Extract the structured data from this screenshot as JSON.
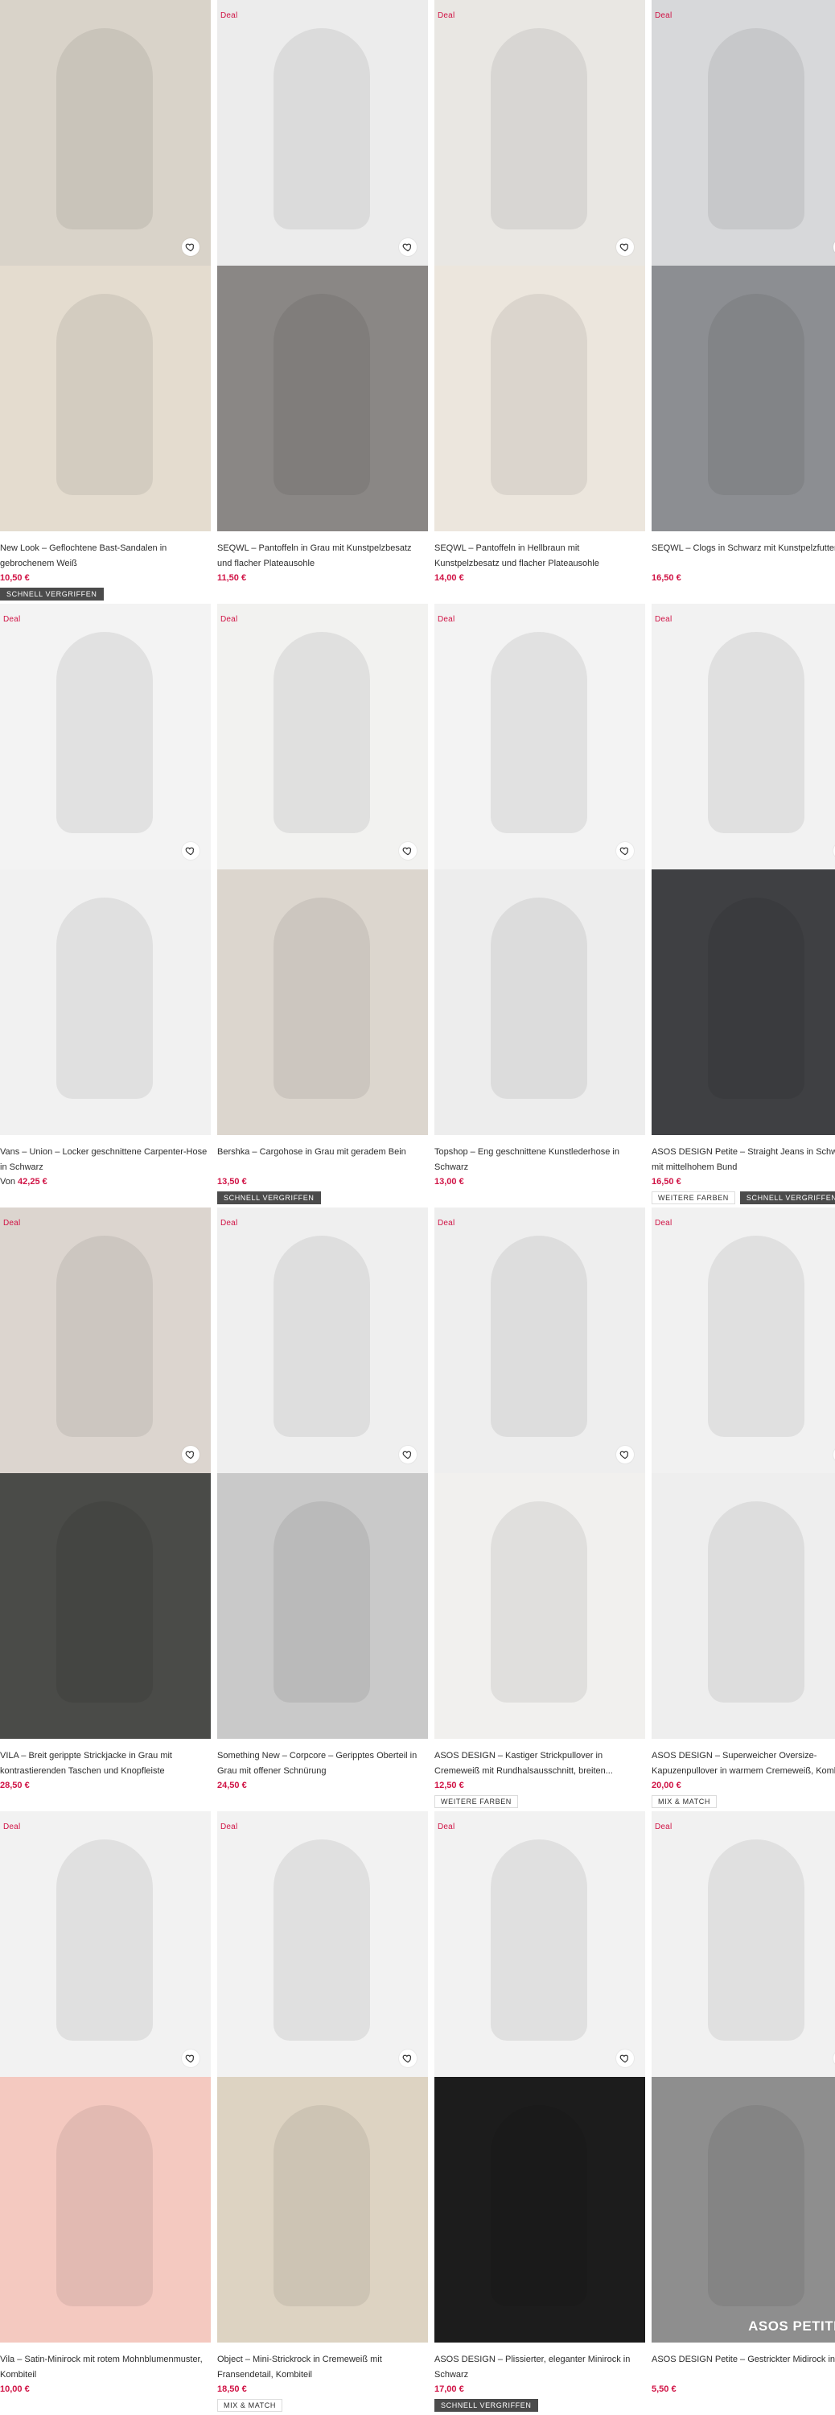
{
  "products": [
    {
      "title": "New Look – Geflochtene Bast-Sandalen in gebrochenem Weiß",
      "price": "10,50 €",
      "deal": "",
      "quick": "SCHNELL VERGRIFFEN",
      "tags": [],
      "img_top": "#d9d3c9",
      "img_bottom": "#e4dccf"
    },
    {
      "title": "SEQWL – Pantoffeln in Grau mit Kunstpelzbesatz und flacher Plateausohle",
      "price": "11,50 €",
      "deal": "Deal",
      "quick": "",
      "tags": [],
      "img_top": "#ececec",
      "img_bottom": "#8a8785"
    },
    {
      "title": "SEQWL – Pantoffeln in Hellbraun mit Kunstpelzbesatz und flacher Plateausohle",
      "price": "14,00 €",
      "deal": "Deal",
      "quick": "",
      "tags": [],
      "img_top": "#e9e7e3",
      "img_bottom": "#ece6dd"
    },
    {
      "title": "SEQWL – Clogs in Schwarz mit Kunstpelzfutter",
      "price": "16,50 €",
      "deal": "Deal",
      "quick": "",
      "tags": [],
      "img_top": "#d7d8da",
      "img_bottom": "#8c8e92"
    },
    {
      "title": "Vans – Union – Locker geschnittene Carpenter-Hose in Schwarz",
      "price_prefix": "Von ",
      "price": "42,25 €",
      "deal": "Deal",
      "quick": "",
      "tags": [],
      "img_top": "#f3f3f3",
      "img_bottom": "#f1f1f1"
    },
    {
      "title": "Bershka – Cargohose in Grau mit geradem Bein",
      "price": "13,50 €",
      "deal": "Deal",
      "quick": "SCHNELL VERGRIFFEN",
      "tags": [],
      "img_top": "#f2f2f0",
      "img_bottom": "#dcd6ce"
    },
    {
      "title": "Topshop – Eng geschnittene Kunstlederhose in Schwarz",
      "price": "13,00 €",
      "deal": "Deal",
      "quick": "",
      "tags": [],
      "img_top": "#f3f3f3",
      "img_bottom": "#ededed"
    },
    {
      "title": "ASOS DESIGN Petite – Straight Jeans in Schwarz mit mittelhohem Bund",
      "price": "16,50 €",
      "deal": "Deal",
      "quick": "SCHNELL VERGRIFFEN",
      "tags": [
        "WEITERE FARBEN"
      ],
      "img_top": "#f2f2f2",
      "img_bottom": "#3f4043"
    },
    {
      "title": "VILA – Breit gerippte Strickjacke in Grau mit kontrastierenden Taschen und Knopfleiste",
      "price": "28,50 €",
      "deal": "Deal",
      "quick": "",
      "tags": [],
      "img_top": "#dcd5cf",
      "img_bottom": "#4a4b48"
    },
    {
      "title": "Something New – Corpcore – Geripptes Oberteil in Grau mit offener Schnürung",
      "price": "24,50 €",
      "deal": "Deal",
      "quick": "",
      "tags": [],
      "img_top": "#efefef",
      "img_bottom": "#c9c9c9"
    },
    {
      "title": "ASOS DESIGN – Kastiger Strickpullover in Cremeweiß mit Rundhalsausschnitt, breiten...",
      "price": "12,50 €",
      "deal": "Deal",
      "quick": "",
      "tags": [
        "WEITERE FARBEN"
      ],
      "img_top": "#eeeeee",
      "img_bottom": "#f1f0ee"
    },
    {
      "title": "ASOS DESIGN – Superweicher Oversize-Kapuzenpullover in warmem Cremeweiß, Kombi",
      "price": "20,00 €",
      "deal": "Deal",
      "quick": "",
      "tags": [
        "MIX & MATCH"
      ],
      "img_top": "#f1f1f1",
      "img_bottom": "#eeeeee"
    },
    {
      "title": "Vila – Satin-Minirock mit rotem Mohnblumenmuster, Kombiteil",
      "price": "10,00 €",
      "deal": "Deal",
      "quick": "",
      "tags": [],
      "img_top": "#f2f2f2",
      "img_bottom": "#f4c9c0"
    },
    {
      "title": "Object – Mini-Strickrock in Cremeweiß mit Fransendetail, Kombiteil",
      "price": "18,50 €",
      "deal": "Deal",
      "quick": "",
      "tags": [
        "MIX & MATCH"
      ],
      "img_top": "#f2f2f2",
      "img_bottom": "#ddd3c2"
    },
    {
      "title": "ASOS DESIGN – Plissierter, eleganter Minirock in Schwarz",
      "price": "17,00 €",
      "deal": "Deal",
      "quick": "SCHNELL VERGRIFFEN",
      "tags": [],
      "img_top": "#f2f2f2",
      "img_bottom": "#1c1c1c"
    },
    {
      "title": "ASOS DESIGN Petite – Gestrickter Midirock in",
      "price": "5,50 €",
      "deal": "Deal",
      "quick": "",
      "tags": [],
      "img_top": "#f1f1f1",
      "img_bottom": "#8e8e8e",
      "overlay": "ASOS PETITE"
    }
  ],
  "colors": {
    "deal": "#d01345",
    "price": "#d01345",
    "quick_bg": "#4b4b4b"
  },
  "icons": {
    "save": "heart-icon"
  }
}
